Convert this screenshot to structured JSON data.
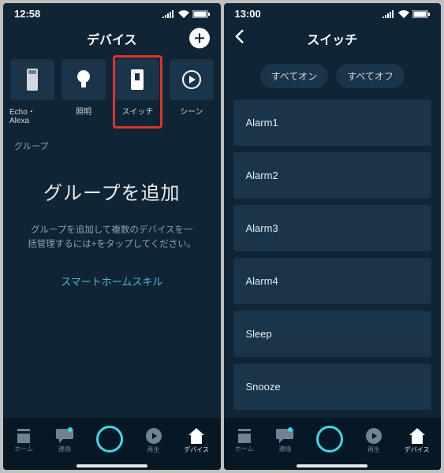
{
  "left": {
    "status": {
      "time": "12:58",
      "carrier_dots": true
    },
    "header": {
      "title": "デバイス"
    },
    "categories": [
      {
        "label": "Echo・Alexa"
      },
      {
        "label": "照明"
      },
      {
        "label": "スイッチ"
      },
      {
        "label": "シーン"
      }
    ],
    "section_label": "グループ",
    "big_text": "グループを追加",
    "sub_text": "グループを追加して複数のデバイスを一括管理するには+をタップしてください。",
    "link_text": "スマートホームスキル",
    "tabs": [
      {
        "label": "ホーム"
      },
      {
        "label": "連絡"
      },
      {
        "label": ""
      },
      {
        "label": "再生"
      },
      {
        "label": "デバイス"
      }
    ]
  },
  "right": {
    "status": {
      "time": "13:00"
    },
    "header": {
      "title": "スイッチ"
    },
    "pills": {
      "all_on": "すべてオン",
      "all_off": "すべてオフ"
    },
    "items": [
      {
        "name": "Alarm1"
      },
      {
        "name": "Alarm2"
      },
      {
        "name": "Alarm3"
      },
      {
        "name": "Alarm4"
      },
      {
        "name": "Sleep"
      },
      {
        "name": "Snooze"
      }
    ],
    "tabs": [
      {
        "label": "ホーム"
      },
      {
        "label": "連絡"
      },
      {
        "label": ""
      },
      {
        "label": "再生"
      },
      {
        "label": "デバイス"
      }
    ]
  }
}
